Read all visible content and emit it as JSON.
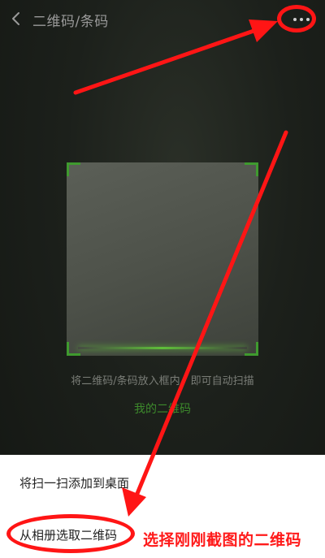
{
  "header": {
    "title": "二维码/条码",
    "back_icon": "chevron-left-icon",
    "more_icon": "more-dots-icon"
  },
  "scanner": {
    "hint": "将二维码/条码放入框内，即可自动扫描",
    "my_qr_link": "我的二维码"
  },
  "sheet": {
    "items": [
      {
        "label": "将扫一扫添加到桌面"
      },
      {
        "label": "从相册选取二维码"
      }
    ]
  },
  "annotation": {
    "text": "选择刚刚截图的二维码",
    "color": "#ff1a1a"
  },
  "colors": {
    "accent_green": "#3d8a2c",
    "highlight_red": "#ff1515",
    "background_dark": "#1c201b",
    "sheet_bg": "#ffffff"
  }
}
